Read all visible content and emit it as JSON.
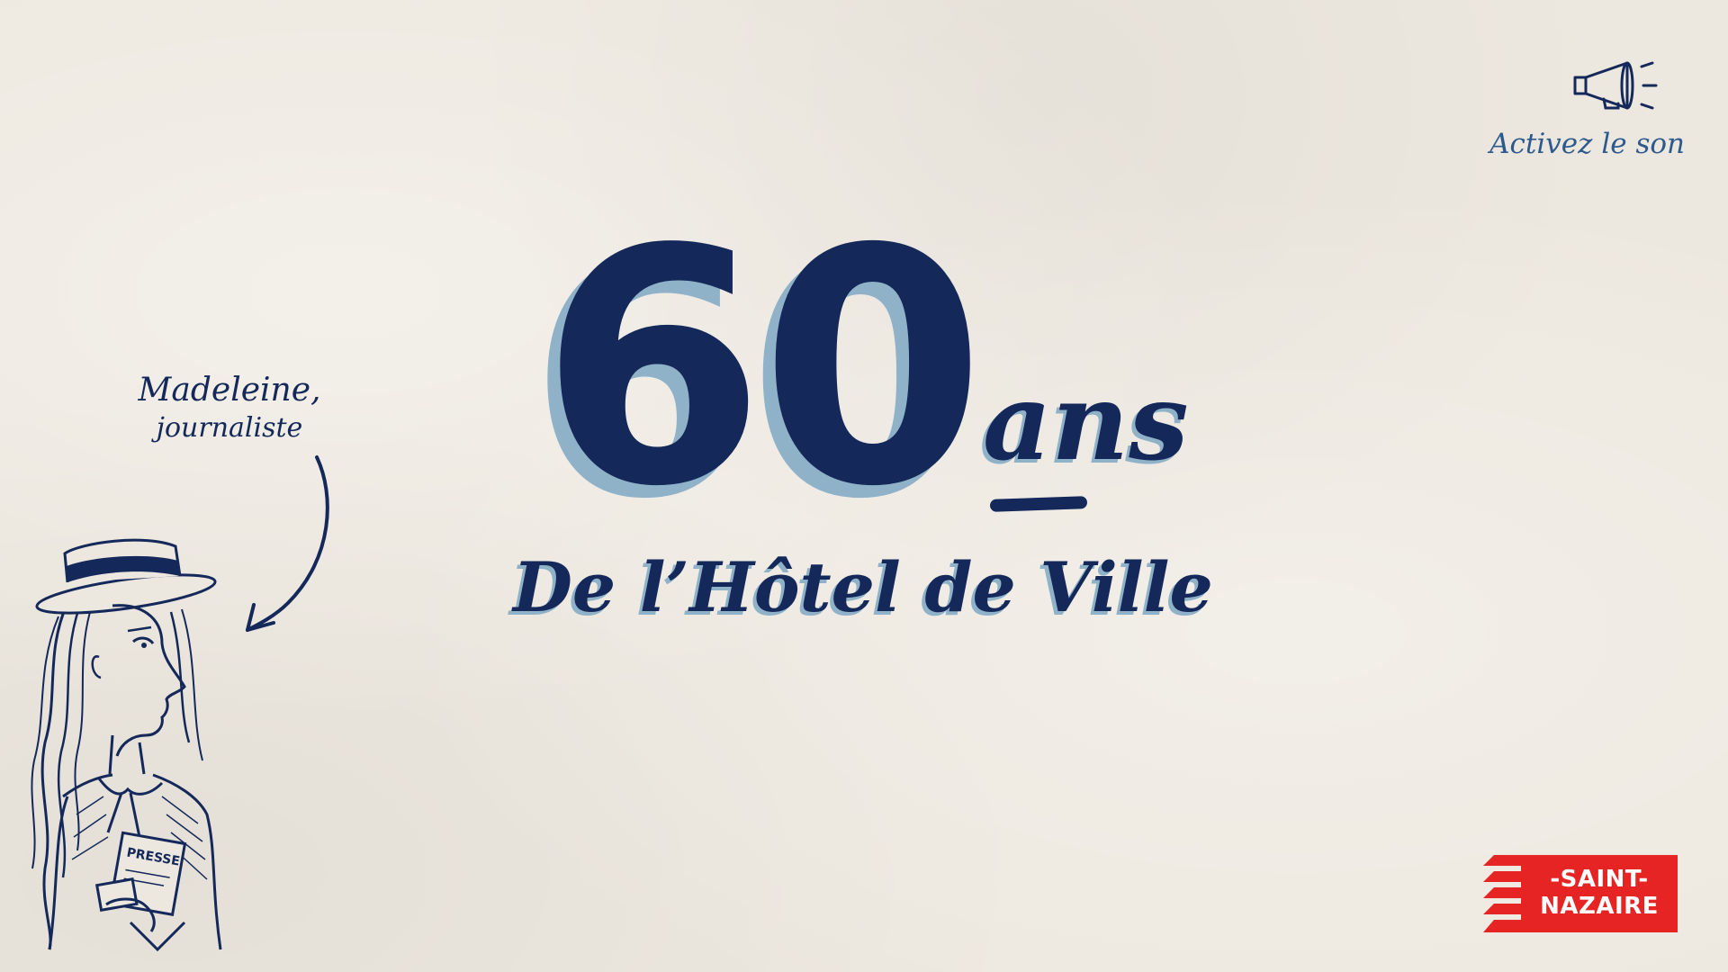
{
  "sound": {
    "icon": "megaphone-icon",
    "label": "Activez le son"
  },
  "title": {
    "number": "60",
    "suffix": "ans",
    "subtitle": "De l’Hôtel de Ville"
  },
  "character": {
    "name": "Madeleine,",
    "role": "journaliste",
    "badge": "PRESSE"
  },
  "logo": {
    "line1": "-SAINT-",
    "line2": "NAZAIRE"
  },
  "colors": {
    "background": "#ede8df",
    "ink": "#14285a",
    "shadow": "#8fb2c9",
    "accent_blue": "#2c5a8e",
    "brand_red": "#e62424"
  }
}
